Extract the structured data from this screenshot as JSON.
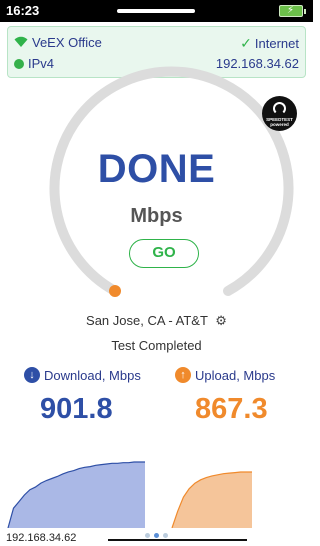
{
  "status_bar": {
    "time": "16:23",
    "battery_icon": "battery-charging-icon"
  },
  "network": {
    "ssid": "VeEX Office",
    "internet_label": "Internet",
    "ip_version": "IPv4",
    "ip_address": "192.168.34.62",
    "wifi_icon": "wifi-icon",
    "check_icon": "check-icon"
  },
  "speedtest_logo": {
    "line1": "SPEEDTEST",
    "line2": "powered"
  },
  "gauge": {
    "state": "DONE",
    "unit": "Mbps",
    "go_label": "GO",
    "track_color": "#dcdcdc",
    "indicator_color": "#f08a2c",
    "level": 0
  },
  "server": {
    "location": "San Jose, CA - AT&T",
    "gear_icon": "gear-icon"
  },
  "status": {
    "text": "Test Completed"
  },
  "results": {
    "download": {
      "label": "Download, Mbps",
      "value": "901.8",
      "color": "#2e4fa6"
    },
    "upload": {
      "label": "Upload, Mbps",
      "value": "867.3",
      "color": "#f08a2c"
    }
  },
  "chart_data": [
    {
      "type": "area",
      "series": [
        {
          "values": [
            0,
            0.3,
            0.4,
            0.5,
            0.58,
            0.62,
            0.68,
            0.72,
            0.75,
            0.78,
            0.82,
            0.85,
            0.87,
            0.9,
            0.92,
            0.93,
            0.95,
            0.96,
            0.97,
            0.98,
            0.98,
            0.99,
            0.99,
            1,
            1,
            1
          ]
        }
      ],
      "color": "#aab8e6"
    },
    {
      "type": "area",
      "series": [
        {
          "values": [
            0,
            0.3,
            0.55,
            0.7,
            0.8,
            0.86,
            0.9,
            0.93,
            0.95,
            0.97,
            0.98,
            0.99,
            1,
            1,
            1
          ]
        }
      ],
      "color": "#f5c59a"
    }
  ],
  "footer": {
    "ip": "192.168.34.62"
  }
}
